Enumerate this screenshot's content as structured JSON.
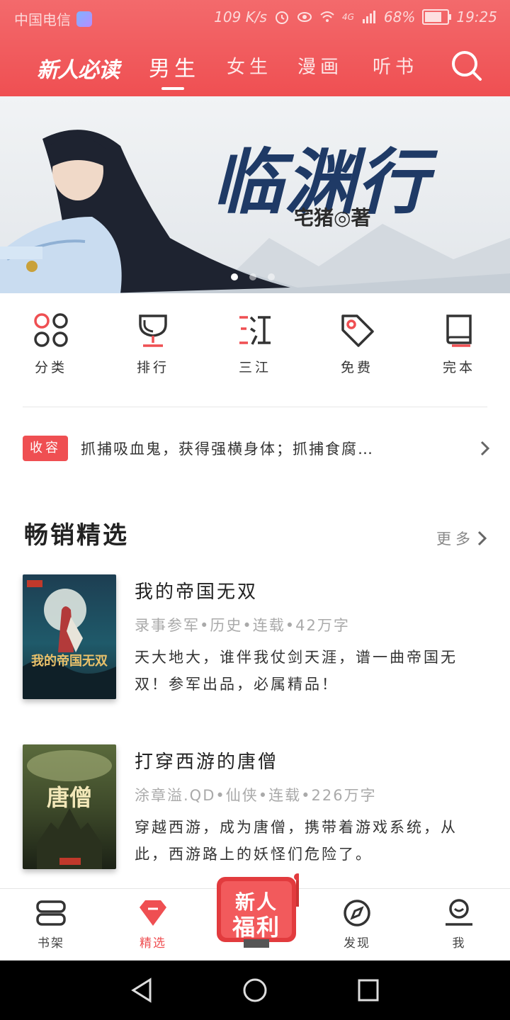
{
  "status_bar": {
    "carrier": "中国电信",
    "speed": "109 K/s",
    "network": "4G",
    "battery": "68%",
    "time": "19:25"
  },
  "header": {
    "logo": "新人必读",
    "tabs": [
      {
        "label": "男生",
        "active": true
      },
      {
        "label": "女生",
        "active": false
      },
      {
        "label": "漫画",
        "active": false
      },
      {
        "label": "听书",
        "active": false
      }
    ]
  },
  "banner": {
    "title": "临渊行",
    "author": "宅猪◎著",
    "page_count": 3,
    "active_page": 1
  },
  "categories": [
    {
      "label": "分类",
      "icon": "category-grid-icon"
    },
    {
      "label": "排行",
      "icon": "trophy-icon"
    },
    {
      "label": "三江",
      "icon": "sanjiang-icon"
    },
    {
      "label": "免费",
      "icon": "tag-icon"
    },
    {
      "label": "完本",
      "icon": "book-icon"
    }
  ],
  "notice": {
    "badge": "收容",
    "text": "抓捕吸血鬼，获得强横身体；抓捕食腐…"
  },
  "section": {
    "title": "畅销精选",
    "more": "更多"
  },
  "books": [
    {
      "title": "我的帝国无双",
      "meta": "录事参军•历史•连载•42万字",
      "desc": "天大地大，谁伴我仗剑天涯，谱一曲帝国无双！参军出品，必属精品！",
      "cover_text": "我的帝国无双"
    },
    {
      "title": "打穿西游的唐僧",
      "meta": "涂章溢.QD•仙侠•连载•226万字",
      "desc": "穿越西游，成为唐僧，携带着游戏系统，从此，西游路上的妖怪们危险了。",
      "cover_text": "唐僧"
    }
  ],
  "bottom_tabs": [
    {
      "label": "书架",
      "icon": "bookshelf-icon",
      "active": false
    },
    {
      "label": "精选",
      "icon": "diamond-icon",
      "active": true
    },
    {
      "label": "发现",
      "icon": "compass-icon",
      "active": false
    },
    {
      "label": "我",
      "icon": "user-icon",
      "active": false
    }
  ],
  "promo": {
    "line1": "新人",
    "line2": "福利"
  },
  "colors": {
    "accent": "#ef4f52",
    "header_top": "#f36a6c",
    "text_dark": "#222222",
    "text_muted": "#aaaaaa"
  }
}
